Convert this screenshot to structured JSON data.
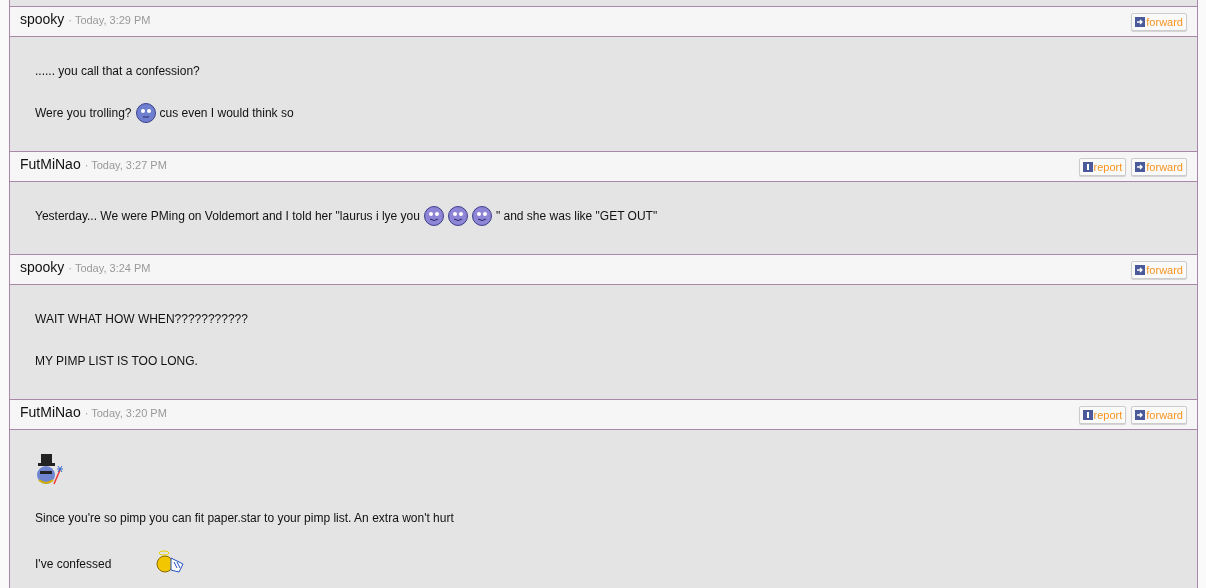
{
  "posts": [
    {
      "author": "spooky",
      "time": "· Today, 3:29 PM",
      "actions": [
        {
          "kind": "forward",
          "label": "forward"
        }
      ],
      "lines": [
        [
          {
            "kind": "text",
            "text": "...... you call that a confession?"
          }
        ],
        [
          {
            "kind": "text",
            "text": "Were you trolling?"
          },
          {
            "kind": "flat-face"
          },
          {
            "kind": "text",
            "text": "cus even I would think so"
          }
        ]
      ]
    },
    {
      "author": "FutMiNao",
      "time": "· Today, 3:27 PM",
      "actions": [
        {
          "kind": "report",
          "label": "report"
        },
        {
          "kind": "forward",
          "label": "forward"
        }
      ],
      "lines": [
        [
          {
            "kind": "text",
            "text": "Yesterday... We were PMing on Voldemort and I told her \"laurus i lye you"
          },
          {
            "kind": "smile-face"
          },
          {
            "kind": "smile-face"
          },
          {
            "kind": "smile-face"
          },
          {
            "kind": "text",
            "text": "\" and she was like \"GET OUT\""
          }
        ]
      ]
    },
    {
      "author": "spooky",
      "time": "· Today, 3:24 PM",
      "actions": [
        {
          "kind": "forward",
          "label": "forward"
        }
      ],
      "lines": [
        [
          {
            "kind": "text",
            "text": "WAIT WHAT HOW WHEN???????????"
          }
        ],
        [
          {
            "kind": "text",
            "text": "MY PIMP LIST IS TOO LONG."
          }
        ]
      ]
    },
    {
      "author": "FutMiNao",
      "time": "· Today, 3:20 PM",
      "actions": [
        {
          "kind": "report",
          "label": "report"
        },
        {
          "kind": "forward",
          "label": "forward"
        }
      ],
      "lines": [
        [
          {
            "kind": "wizard"
          }
        ],
        [
          {
            "kind": "text",
            "text": "Since you're so pimp you can fit paper.star to your pimp list. An extra won't hurt"
          }
        ],
        [
          {
            "kind": "text",
            "text": "I've confessed"
          },
          {
            "kind": "angel"
          }
        ]
      ]
    }
  ]
}
